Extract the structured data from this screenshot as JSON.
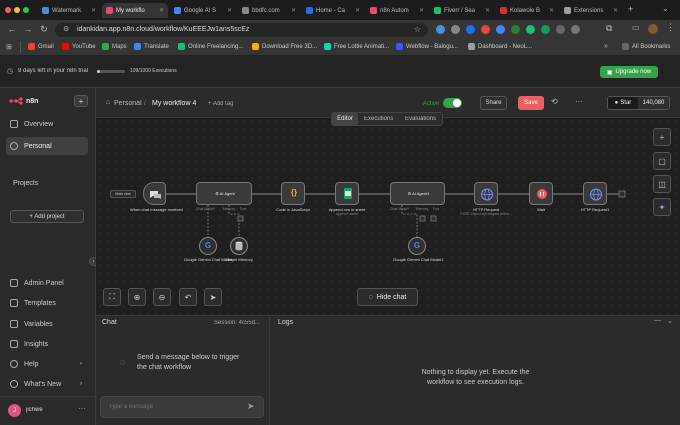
{
  "browser": {
    "tabs": [
      {
        "label": "Watermark",
        "color": "#4a90d9",
        "active": false
      },
      {
        "label": "My workflo",
        "color": "#ea4b71",
        "active": true
      },
      {
        "label": "Google AI S",
        "color": "#4285f4",
        "active": false
      },
      {
        "label": "bbdfc.com",
        "color": "#888888",
        "active": false
      },
      {
        "label": "Home - Ca",
        "color": "#1a73e8",
        "active": false
      },
      {
        "label": "n8n Autom",
        "color": "#ea4b71",
        "active": false
      },
      {
        "label": "Fiverr / Sea",
        "color": "#1dbf73",
        "active": false
      },
      {
        "label": "Kolawole B",
        "color": "#d93025",
        "active": false
      },
      {
        "label": "Extensions",
        "color": "#9aa0a6",
        "active": false
      }
    ],
    "url": "idankidan.app.n8n.cloud/workflow/KuEEEJw1ans5scEz",
    "bookmarks": [
      {
        "label": "Gmail",
        "color": "#ea4335"
      },
      {
        "label": "YouTube",
        "color": "#ff0000"
      },
      {
        "label": "Maps",
        "color": "#34a853"
      },
      {
        "label": "Translate",
        "color": "#4285f4"
      },
      {
        "label": "Online Freelancing...",
        "color": "#1dbf73"
      },
      {
        "label": "Download Free 3D...",
        "color": "#f4b400"
      },
      {
        "label": "Free Lottie Animati...",
        "color": "#00ddb3"
      },
      {
        "label": "Webflow - Balogu...",
        "color": "#4353ff"
      },
      {
        "label": "Dashboard - NeoL...",
        "color": "#9aa0a6"
      }
    ],
    "all_bookmarks": "All Bookmarks"
  },
  "trial": {
    "text": "9 days left in your n8n trial",
    "executions": "109/1000 Executions",
    "progress": 0.109,
    "upgrade": "Upgrade now"
  },
  "sidebar": {
    "logo": "n8n",
    "add": "+",
    "items": [
      "Overview",
      "Personal"
    ],
    "projects_title": "Projects",
    "add_project": "+ Add project",
    "bottom_items": [
      "Admin Panel",
      "Templates",
      "Variables",
      "Insights",
      "Help",
      "What's New"
    ],
    "user": "jichwe",
    "user_initials": "J"
  },
  "header": {
    "breadcrumb_root": "Personal",
    "workflow_name": "My workflow 4",
    "add_tag": "+ Add tag",
    "active_label": "Active",
    "active": true,
    "share": "Share",
    "save": "Save",
    "github_star": "Star",
    "github_count": "140,080"
  },
  "tabs": {
    "items": [
      "Editor",
      "Executions",
      "Evaluations"
    ],
    "active": "Editor"
  },
  "nodes": {
    "chat_trigger_badge": "Main chat",
    "chat_trigger": "When chat message received",
    "agent1": "AI Agent",
    "agent1_sub_model": "Chat Model*",
    "agent1_sub_memory": "Memory",
    "agent1_sub_tool": "Tool",
    "code": "Code in JavaScript",
    "sheets": "Append row in sheet",
    "sheets_sub": "append: sheet",
    "agent2": "AI Agent1",
    "agent2_sub_model": "Chat Model*",
    "agent2_sub_memory": "Memory",
    "agent2_sub_tool": "Tool",
    "http1": "HTTP Request",
    "http1_sub": "POST: https://api.elegant.ai/em...",
    "wait": "Wait",
    "http2": "HTTP Request1",
    "gemini1": "Google Gemini Chat Model",
    "memory1": "Simple Memory",
    "gemini2": "Google Gemini Chat Model1"
  },
  "canvas": {
    "hide_chat": "Hide chat"
  },
  "chat": {
    "title": "Chat",
    "session": "Session: 4c55d...",
    "empty_msg": "Send a message below to trigger the chat workflow",
    "placeholder": "Type a message"
  },
  "logs": {
    "title": "Logs",
    "empty": "Nothing to display yet. Execute the workflow to see execution logs."
  }
}
